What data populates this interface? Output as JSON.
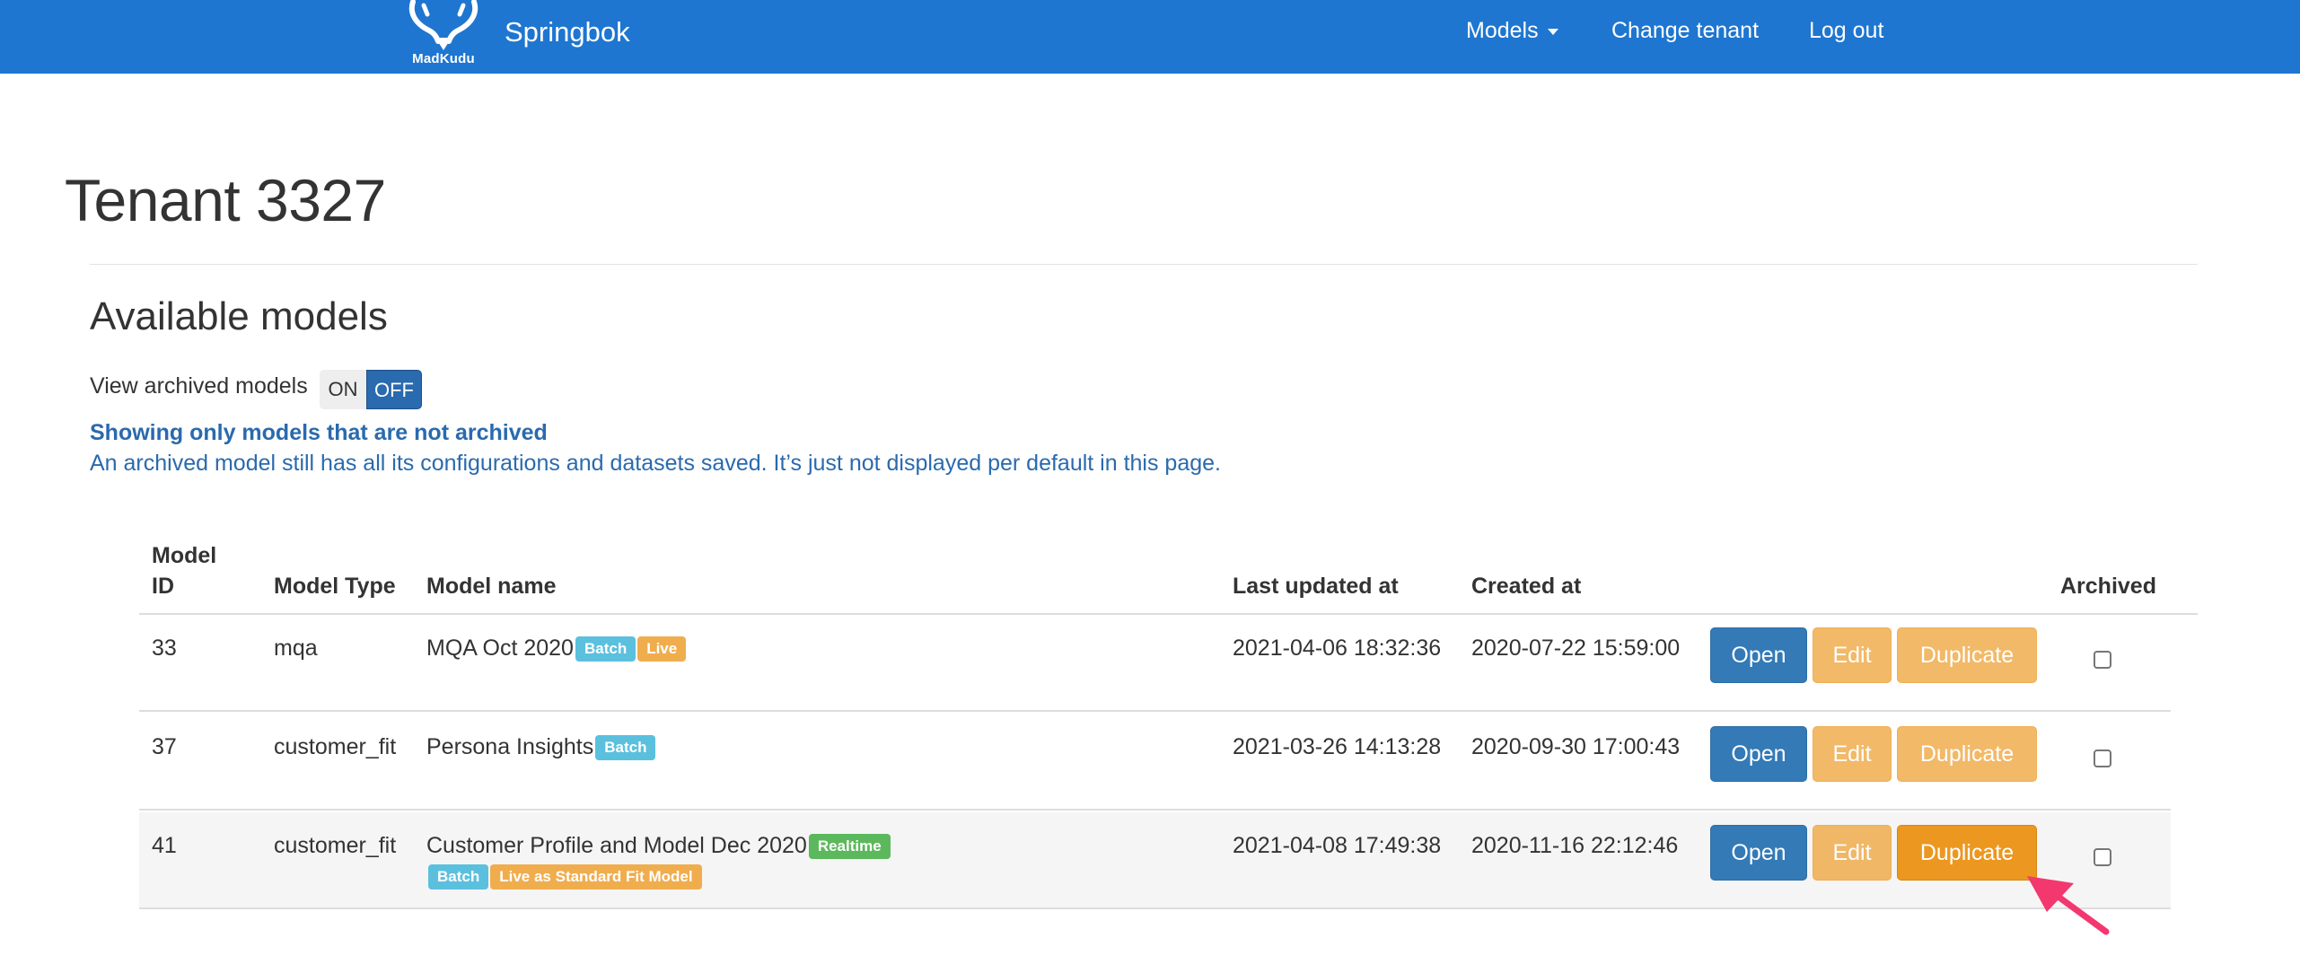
{
  "navbar": {
    "logo_text": "MadKudu",
    "brand": "Springbok",
    "menu": {
      "models": "Models",
      "change_tenant": "Change tenant",
      "log_out": "Log out"
    }
  },
  "page": {
    "title": "Tenant 3327"
  },
  "section": {
    "title": "Available models"
  },
  "toggle": {
    "label": "View archived models",
    "on": "ON",
    "off": "OFF",
    "selected": "OFF"
  },
  "info": {
    "strong": "Showing only models that are not archived",
    "text": "An archived model still has all its configurations and datasets saved. It’s just not displayed per default in this page."
  },
  "table": {
    "headers": {
      "model_id_line1": "Model",
      "model_id_line2": "ID",
      "model_type": "Model Type",
      "model_name": "Model name",
      "last_updated": "Last updated at",
      "created": "Created at",
      "archived": "Archived"
    },
    "buttons": {
      "open": "Open",
      "edit": "Edit",
      "duplicate": "Duplicate"
    },
    "rows": [
      {
        "id": "33",
        "type": "mqa",
        "name": "MQA Oct 2020",
        "labels": [
          {
            "text": "Batch",
            "color": "#5bc0de"
          },
          {
            "text": "Live",
            "color": "#f0ad4e"
          }
        ],
        "last_updated": "2021-04-06 18:32:36",
        "created": "2020-07-22 15:59:00",
        "archived": false
      },
      {
        "id": "37",
        "type": "customer_fit",
        "name": "Persona Insights",
        "labels": [
          {
            "text": "Batch",
            "color": "#5bc0de"
          }
        ],
        "last_updated": "2021-03-26 14:13:28",
        "created": "2020-09-30 17:00:43",
        "archived": false
      },
      {
        "id": "41",
        "type": "customer_fit",
        "name": "Customer Profile and Model Dec 2020",
        "labels": [
          {
            "text": "Realtime",
            "color": "#5cb85c"
          },
          {
            "text": "Batch",
            "color": "#5bc0de"
          },
          {
            "text": "Live as Standard Fit Model",
            "color": "#f0ad4e"
          }
        ],
        "last_updated": "2021-04-08 17:49:38",
        "created": "2020-11-16 22:12:46",
        "archived": false
      }
    ]
  },
  "colors": {
    "navbar": "#1e76d0",
    "primary": "#337ab7",
    "warning": "#f0ad4e",
    "info_text": "#2a6aae",
    "arrow": "#f2386f"
  },
  "annotation": {
    "icon": "pointer-arrow-icon"
  }
}
